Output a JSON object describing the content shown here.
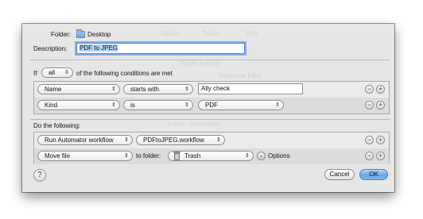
{
  "folder_row": {
    "label": "Folder:",
    "value": "Desktop"
  },
  "description_row": {
    "label": "Description:",
    "value": "PDF to JPEG"
  },
  "conditions_line": {
    "prefix": "If",
    "match_value": "all",
    "suffix": "of the following conditions are met"
  },
  "criteria": [
    {
      "attribute": "Name",
      "operator": "starts with",
      "value": "Ally check"
    },
    {
      "attribute": "Kind",
      "operator": "is",
      "value": "PDF"
    }
  ],
  "do_following_label": "Do the following:",
  "actions": [
    {
      "action": "Run Automator workflow",
      "target": "PDFtoJPEG.workflow"
    },
    {
      "action": "Move file",
      "to_label": "to folder:",
      "target": "Trash",
      "options_label": "Options"
    }
  ],
  "footer": {
    "help_label": "?",
    "cancel_label": "Cancel",
    "ok_label": "OK"
  },
  "icons": {
    "popup_arrows": "⇕",
    "plus": "+",
    "minus": "−",
    "options_chevron": "⌄"
  },
  "background_ghost_text": {
    "tab_folders": "Folders",
    "tab_trash": "Trash",
    "tab_info": "Info",
    "pane_title": "Folder Actions",
    "pane_subtitle": "Duplicate Files",
    "note": "Enter a description",
    "col_active": "Active",
    "col_description": "Description"
  },
  "colors": {
    "sheet_bg": "#e6e6e6",
    "focus_ring": "#7fb1ec",
    "default_button": "#6aa6ea"
  }
}
